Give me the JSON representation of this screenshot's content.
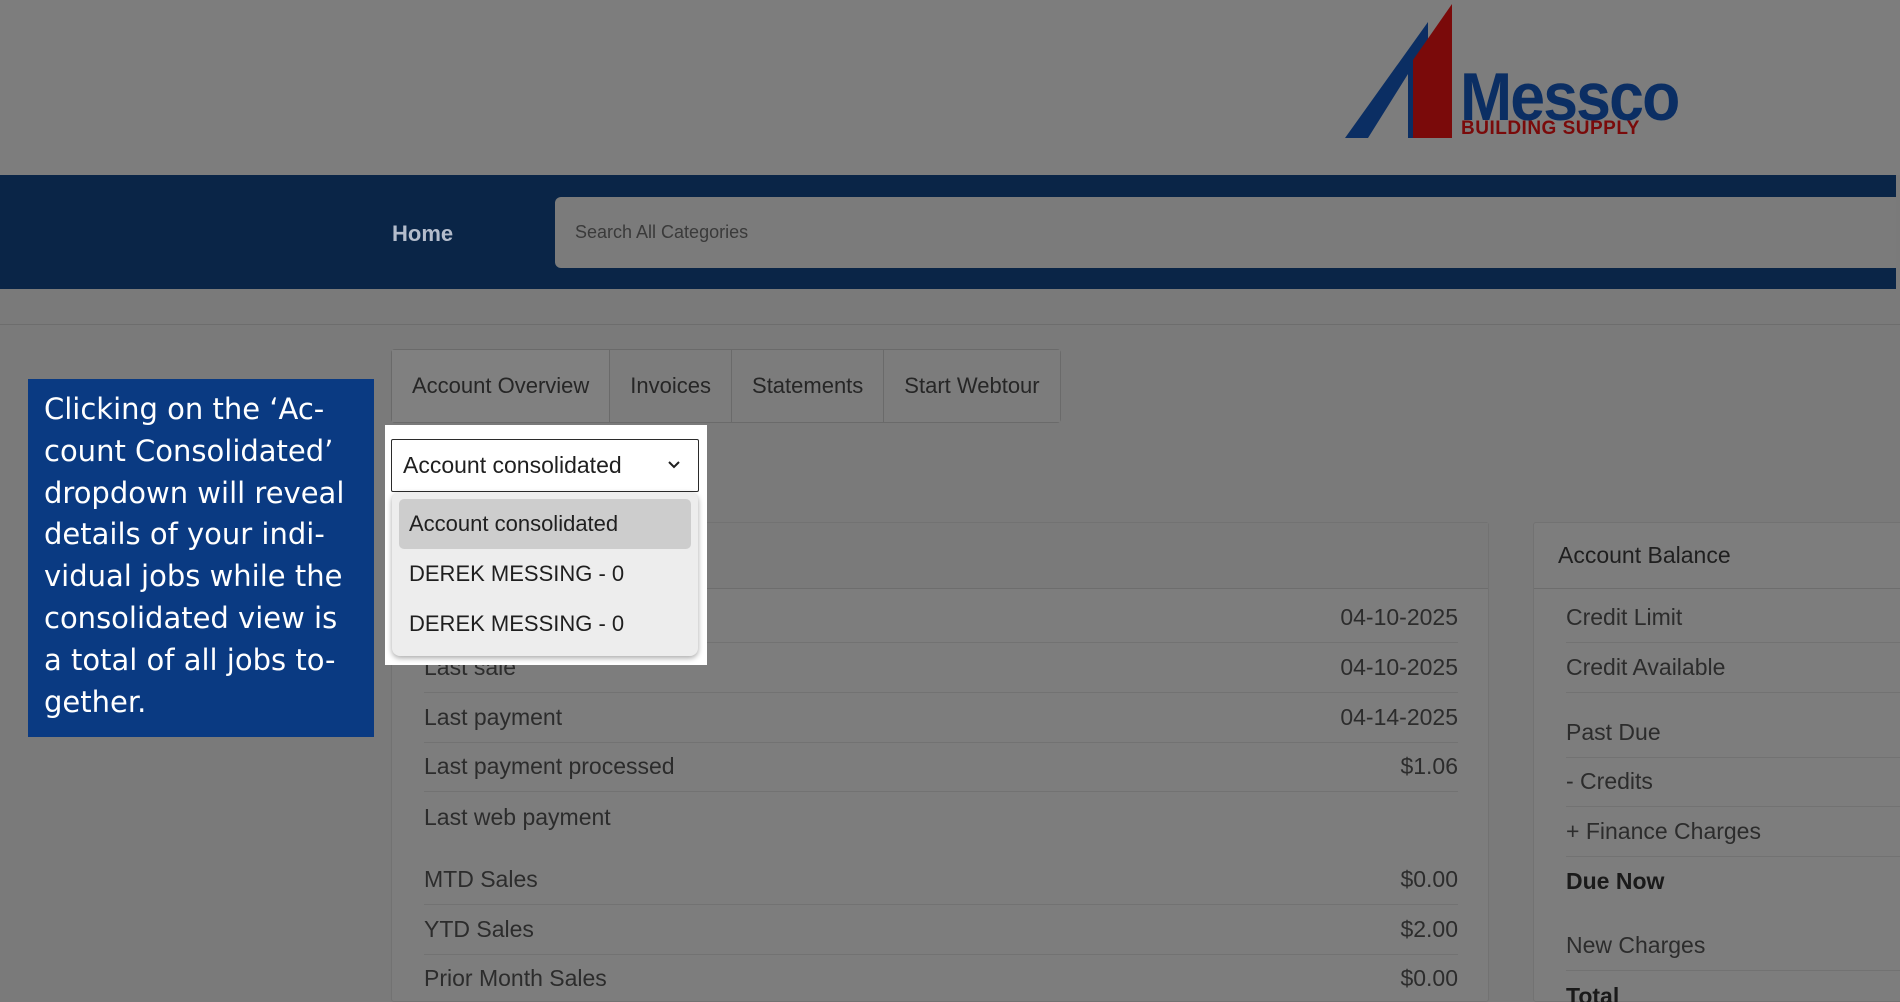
{
  "header": {
    "logo": {
      "word": "Messco",
      "sub": "BUILDING SUPPLY"
    }
  },
  "nav": {
    "home_label": "Home",
    "search_placeholder": "Search All Categories"
  },
  "tabs": [
    {
      "label": "Account Overview",
      "active": true
    },
    {
      "label": "Invoices",
      "active": false
    },
    {
      "label": "Statements",
      "active": false
    },
    {
      "label": "Start Webtour",
      "active": false
    }
  ],
  "callout": {
    "lines": [
      "Clicking on the ‘Ac-",
      "count Consolidated’",
      "dropdown will reveal",
      "details of your indi-",
      "vidual jobs while the",
      "consolidated view is",
      "a total of all jobs to-",
      "gether."
    ]
  },
  "account_select": {
    "value": "Account consolidated",
    "icon": "chevron-down-icon",
    "options": [
      {
        "label": "Account consolidated",
        "selected": true
      },
      {
        "label": "DEREK MESSING - 0",
        "selected": false
      },
      {
        "label": "DEREK MESSING - 0",
        "selected": false
      }
    ]
  },
  "overview": {
    "rows": [
      {
        "label": "",
        "value": "04-10-2025"
      },
      {
        "label": "Last sale",
        "value": "04-10-2025"
      },
      {
        "label": "Last payment",
        "value": "04-14-2025"
      },
      {
        "label": "Last payment processed",
        "value": "$1.06"
      },
      {
        "label": "Last web payment",
        "value": ""
      },
      {
        "label": "MTD Sales",
        "value": "$0.00"
      },
      {
        "label": "YTD Sales",
        "value": "$2.00"
      },
      {
        "label": "Prior Month Sales",
        "value": "$0.00"
      }
    ]
  },
  "balance": {
    "title": "Account Balance",
    "rows": [
      {
        "label": "Credit Limit",
        "bold": false
      },
      {
        "label": "Credit Available",
        "bold": false
      },
      {
        "label": "Past Due",
        "bold": false
      },
      {
        "label": "- Credits",
        "bold": false
      },
      {
        "label": "+ Finance Charges",
        "bold": false
      },
      {
        "label": "Due Now",
        "bold": true
      },
      {
        "label": "New Charges",
        "bold": false
      },
      {
        "label": "Total",
        "bold": true
      }
    ]
  },
  "colors": {
    "nav_bg": "#0a2547",
    "callout_bg": "#0a3a82",
    "logo_blue": "#0b2e63",
    "logo_red": "#7a0a0a"
  }
}
